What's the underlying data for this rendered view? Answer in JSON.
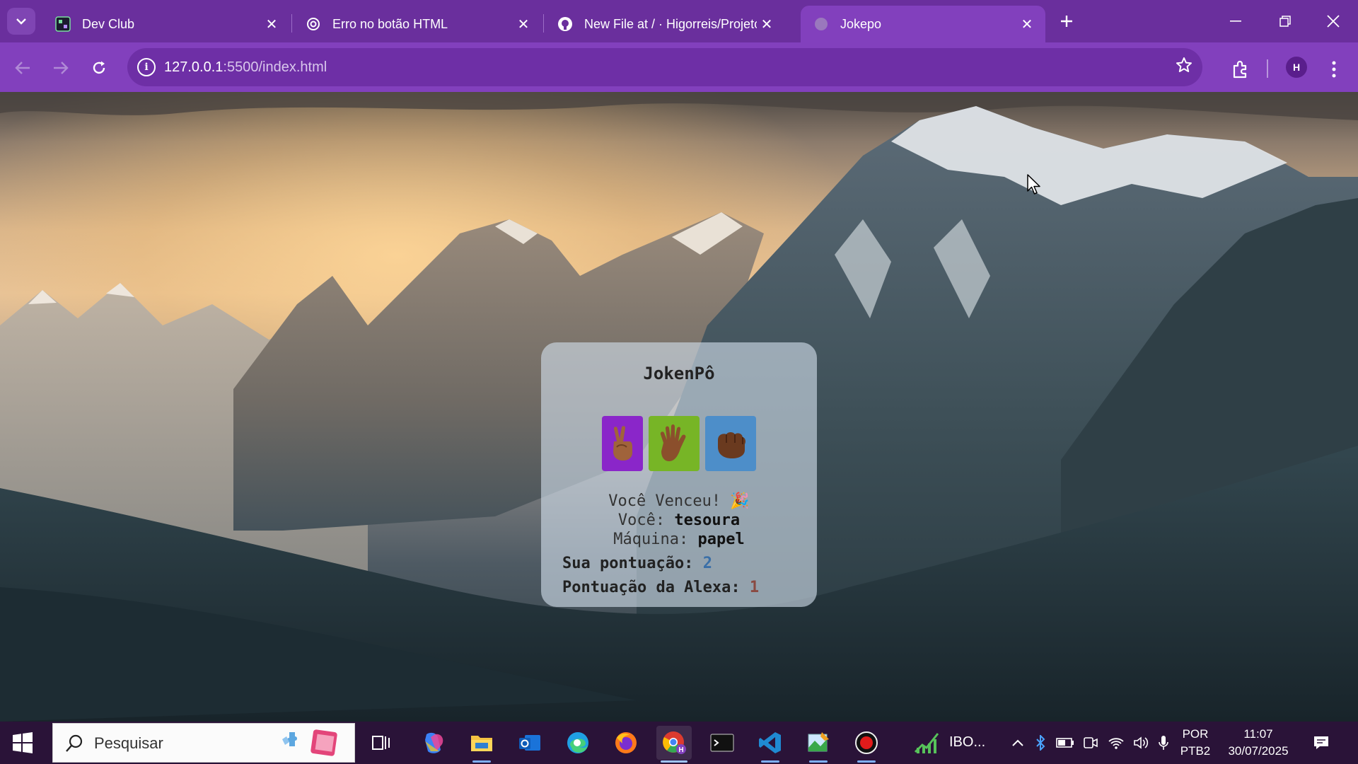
{
  "browser": {
    "tabs": [
      {
        "title": "Dev Club",
        "active": false
      },
      {
        "title": "Erro no botão HTML",
        "active": false
      },
      {
        "title": "New File at / · Higorreis/Projeto",
        "active": false
      },
      {
        "title": "Jokepo",
        "active": true
      }
    ],
    "address": {
      "host": "127.0.0.1",
      "path": ":5500/index.html"
    },
    "profile_initial": "H",
    "accent_color": "#8240bd"
  },
  "game": {
    "title": "JokenPô",
    "choices": [
      {
        "name": "tesoura",
        "icon": "victory-hand-icon",
        "color": "#8a26c9"
      },
      {
        "name": "papel",
        "icon": "raised-hand-icon",
        "color": "#77b526"
      },
      {
        "name": "pedra",
        "icon": "fist-icon",
        "color": "#4d8ec9"
      }
    ],
    "result_text": "Você Venceu! 🎉",
    "you_label": "Você:",
    "you_choice": "tesoura",
    "machine_label": "Máquina:",
    "machine_choice": "papel",
    "score_you_label": "Sua pontuação:",
    "score_you_value": "2",
    "score_alexa_label": "Pontuação da Alexa:",
    "score_alexa_value": "1"
  },
  "taskbar": {
    "search_placeholder": "Pesquisar",
    "pinned_label": "IBO...",
    "language_line1": "POR",
    "language_line2": "PTB2",
    "time": "11:07",
    "date": "30/07/2025"
  }
}
